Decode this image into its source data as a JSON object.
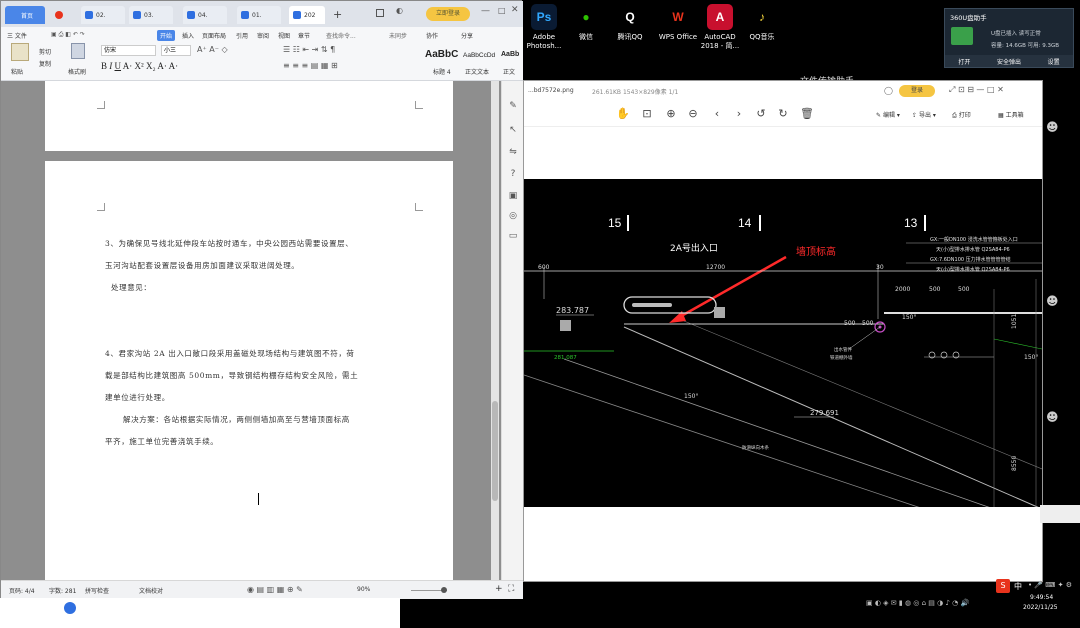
{
  "desktop": {
    "icons": [
      {
        "label": "Adobe Photosh...",
        "glyph": "Ps",
        "color": "#0a1b33",
        "fg": "#31a8ff"
      },
      {
        "label": "微信",
        "glyph": "●",
        "color": "#000000",
        "fg": "#2dc100"
      },
      {
        "label": "腾讯QQ",
        "glyph": "Q",
        "color": "#000000",
        "fg": "#ffffff"
      },
      {
        "label": "WPS Office",
        "glyph": "W",
        "color": "#000000",
        "fg": "#e8331c"
      },
      {
        "label": "AutoCAD 2018 - 简...",
        "glyph": "A",
        "color": "#c8102e",
        "fg": "#ffffff"
      },
      {
        "label": "QQ音乐",
        "glyph": "♪",
        "color": "#000000",
        "fg": "#f4d43b"
      }
    ],
    "right_label": "文件传输助手"
  },
  "notification": {
    "title": "360U盘助手",
    "line1": "U盘已插入 读写正常",
    "line2": "容量: 14.6GB  可用: 9.3GB",
    "buttons": [
      "打开",
      "安全弹出",
      "设置"
    ]
  },
  "wps": {
    "tabs": [
      {
        "label": "首页"
      },
      {
        "label": ""
      },
      {
        "label": "02."
      },
      {
        "label": "03."
      },
      {
        "label": "04."
      },
      {
        "label": "01."
      },
      {
        "label": "202"
      }
    ],
    "vip_label": "立即登录",
    "menu": [
      "三 文件",
      "开始",
      "插入",
      "页面布局",
      "引用",
      "审阅",
      "视图",
      "章节",
      "查找命令...",
      "未同步",
      "协作",
      "分享"
    ],
    "font_name": "仿宋",
    "font_size": "小三",
    "styles": [
      {
        "preview": "AaBbC",
        "name": "标题 4"
      },
      {
        "preview": "AaBbCcDd",
        "name": "正文文本"
      },
      {
        "preview": "AaBb",
        "name": "正文"
      }
    ],
    "paste_labels": [
      "粘贴",
      "剪切",
      "复制",
      "格式刷"
    ],
    "paragraphs": {
      "p3_line1": "3、为确保见号线北延伸段车站按时通车，中央公园西站需要设置层、",
      "p3_line2": "玉河沟站配套设置层设备用房加面建议采取进阔处理。",
      "p3_opinion": "处理意见：",
      "p4_line1": "4、君家沟站 2A 出入口敞口段采用盖磁处现场结构与建筑图不符，荷",
      "p4_line2": "载是部结构比建筑图高 500mm，导致钢结构棚存结构安全风险，需土",
      "p4_line3": "建单位进行处理。",
      "p4_solution1": "解决方案：各站根据实际情况，两侧侧墙加高至与营墙顶面标高",
      "p4_solution2": "平齐，施工单位完善浇筑手续。"
    },
    "status": {
      "page": "页码: 4/4",
      "words": "字数: 281",
      "spell": "拼写检查",
      "doc_check": "文档校对",
      "zoom": "90%"
    }
  },
  "viewer": {
    "title": "...bd7572e.png",
    "title_meta": "261.61KB  1543×829像素  1/1",
    "login": "登录",
    "actions": [
      "编辑",
      "导出",
      "打印",
      "工具箱"
    ],
    "toolbar_icons": [
      "hand-icon",
      "fit-icon",
      "zoom-in-icon",
      "zoom-out-icon",
      "prev-icon",
      "next-icon",
      "rotate-left-icon",
      "rotate-right-icon",
      "delete-icon"
    ]
  },
  "drawing": {
    "axis_labels": [
      "15",
      "14",
      "13"
    ],
    "entrance": "2A号出入口",
    "annotation": "墙顶标高",
    "dims": [
      "600",
      "12700",
      "30",
      "2000",
      "500",
      "500",
      "500",
      "500",
      "1051",
      "8550"
    ],
    "elevations": [
      "283.787",
      "281.087",
      "279.691"
    ],
    "notes": [
      "GX:一般DN100  浸洗水管管箍板处入口",
      "天(小)型排水排水管 Q2SA84-P6",
      "GX:7.6DN100  压力排水管管管管结",
      "天(小)型排水排水管 Q2SA84-P6"
    ],
    "small_notes": [
      "出水管件",
      "铁道棚外墙",
      "防滑纵向木条"
    ],
    "angles": [
      "150°",
      "150°",
      "150°"
    ]
  },
  "taskbar": {
    "time": "9:49:54",
    "date": "2022/11/25",
    "ime": "中"
  }
}
